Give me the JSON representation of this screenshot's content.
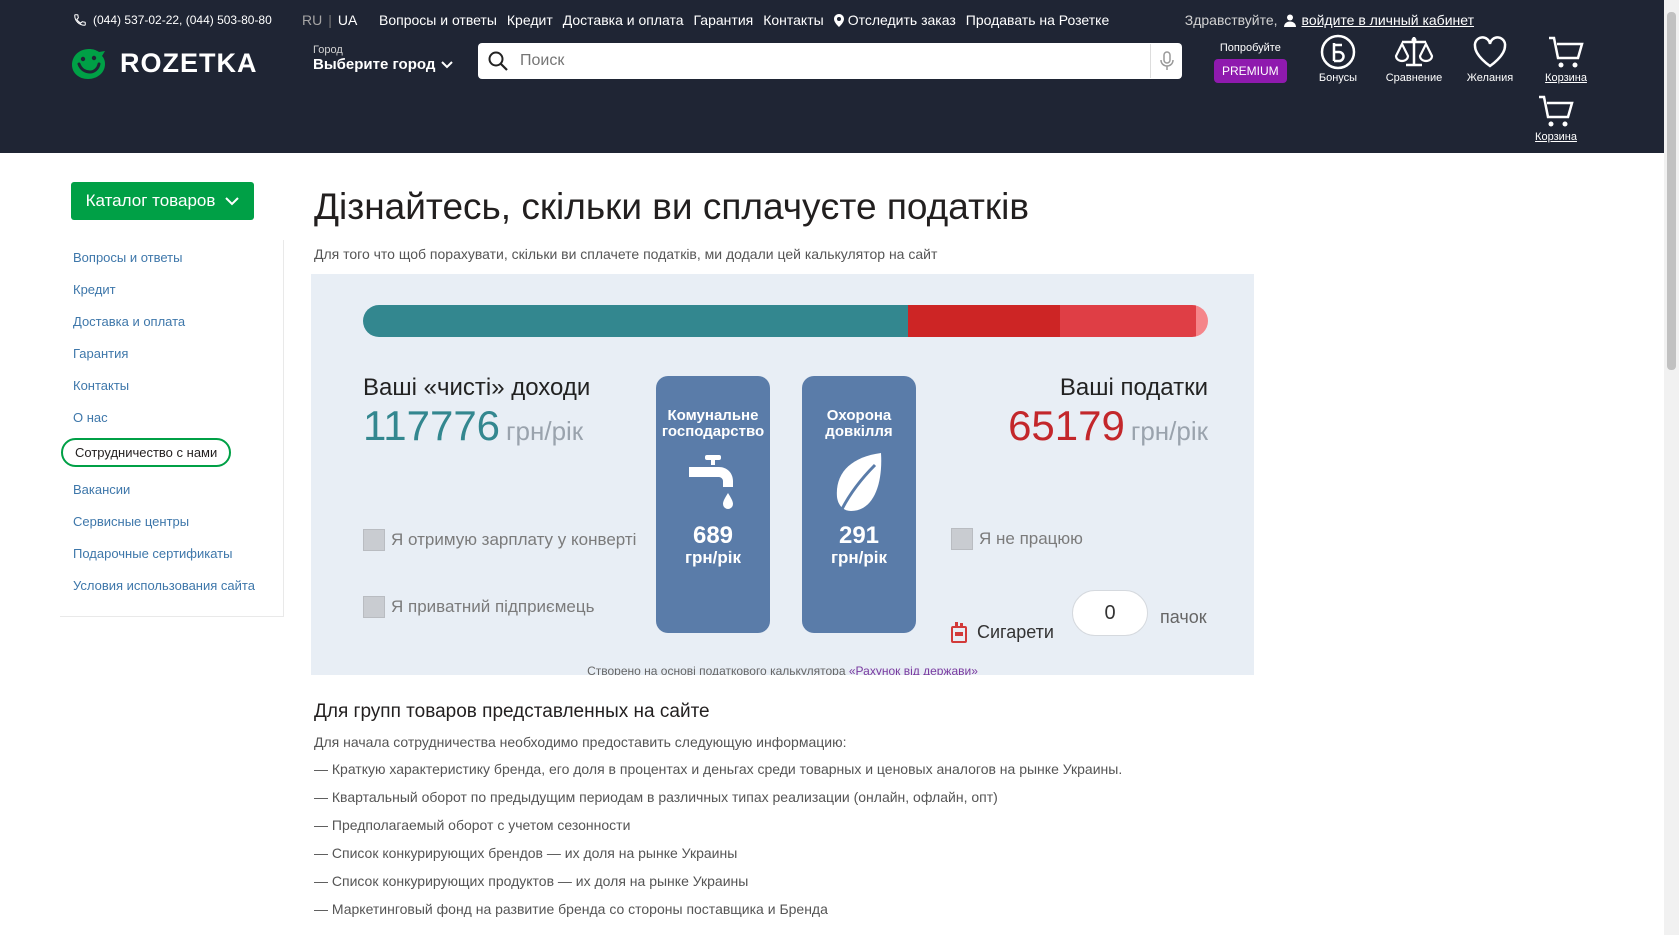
{
  "header": {
    "phones": "(044) 537-02-22, (044) 503-80-80",
    "lang_ru": "RU",
    "lang_ua": "UA",
    "links": [
      "Вопросы и ответы",
      "Кредит",
      "Доставка и оплата",
      "Гарантия",
      "Контакты"
    ],
    "track_order": "Отследить заказ",
    "sell": "Продавать на Розетке",
    "greeting": "Здравствуйте,",
    "login": "войдите в личный кабинет",
    "logo_text": "ROZETKA",
    "city_label": "Город",
    "city_value": "Выберите город",
    "search_placeholder": "Поиск",
    "premium_try": "Попробуйте",
    "premium_badge": "PREMIUM",
    "bonuses": "Бонусы",
    "compare": "Сравнение",
    "wishes": "Желания",
    "cart": "Корзина",
    "cart2": "Корзина"
  },
  "sidebar": {
    "catalog_button": "Каталог товаров",
    "items": [
      "Вопросы и ответы",
      "Кредит",
      "Доставка и оплата",
      "Гарантия",
      "Контакты",
      "О нас",
      "Сотрудничество с нами",
      "Вакансии",
      "Сервисные центры",
      "Подарочные сертификаты",
      "Условия использования сайта"
    ],
    "active_index": 6
  },
  "main": {
    "title": "Дізнайтесь, скільки ви сплачуєте податків",
    "lead": "Для того что щоб порахувати, скільки ви сплачете податків, ми додали цей калькулятор на сайт"
  },
  "calculator": {
    "net_title": "Ваші «чисті» доходи",
    "net_value": "117776",
    "unit": "грн/рік",
    "tax_title": "Ваші податки",
    "tax_value": "65179",
    "check_envelope": "Я отримую зарплату у конверті",
    "check_entrepreneur": "Я приватний підприємець",
    "check_not_working": "Я не працюю",
    "card_utilities_title": "Комунальне господарство",
    "card_utilities_value": "689",
    "card_environment_title": "Охорона довкілля",
    "card_environment_value": "291",
    "cigarettes_label": "Сигарети",
    "cigarettes_value": "0",
    "packs_label": "пачок",
    "credit_text": "Створено на основі податкового калькулятора",
    "credit_link": "«Рахунок від держави»",
    "colors": {
      "net": "#33878f",
      "tax": "#cd2525",
      "card": "#5a7ca9"
    }
  },
  "content": {
    "heading": "Для групп товаров представленных на сайте",
    "intro": "Для начала сотрудничества необходимо предоставить следующую информацию:",
    "list": [
      "— Краткую характеристику бренда, его доля в процентах и деньгах среди товарных и ценовых аналогов на рынке Украины.",
      "— Квартальный оборот по предыдущим периодам в различных типах реализации (онлайн, офлайн, опт)",
      "— Предполагаемый оборот с учетом сезонности",
      "— Список конкурирующих брендов — их доля на рынке Украины",
      "— Список конкурирующих продуктов — их доля на рынке Украины",
      "— Маркетинговый фонд на развитие бренда со стороны поставщика и Бренда"
    ]
  }
}
